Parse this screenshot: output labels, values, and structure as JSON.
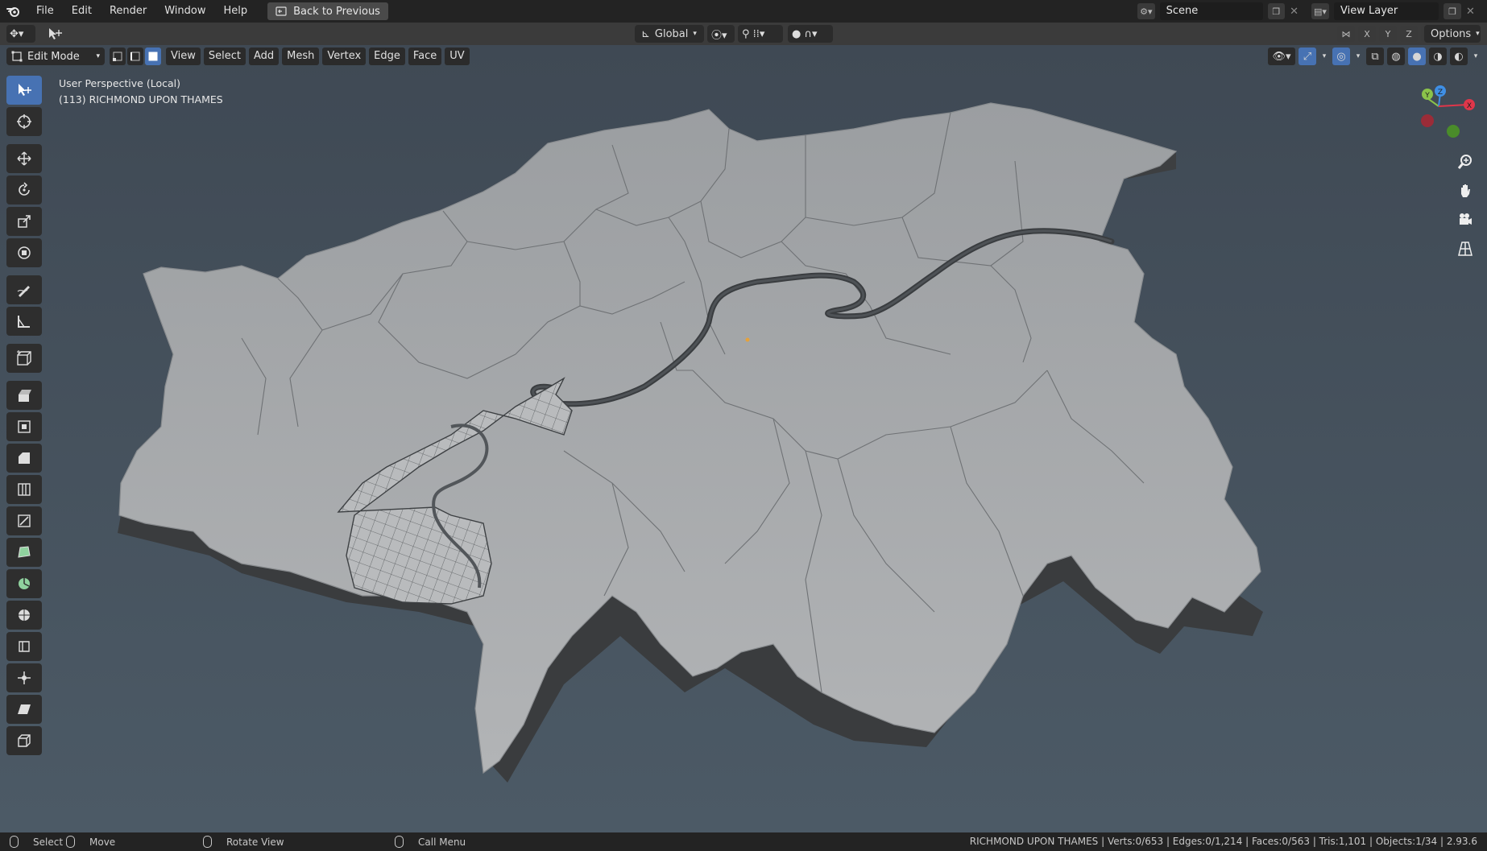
{
  "topbar": {
    "menus": [
      "File",
      "Edit",
      "Render",
      "Window",
      "Help"
    ],
    "back_label": "Back to Previous",
    "scene_name": "Scene",
    "view_layer": "View Layer"
  },
  "toolheader": {
    "orientation": "Global",
    "axes": [
      "X",
      "Y",
      "Z"
    ],
    "options_label": "Options"
  },
  "viewport_header": {
    "mode": "Edit Mode",
    "menus": [
      "View",
      "Select",
      "Add",
      "Mesh",
      "Vertex",
      "Edge",
      "Face",
      "UV"
    ]
  },
  "overlay": {
    "perspective": "User Perspective (Local)",
    "object": "(113) RICHMOND UPON THAMES"
  },
  "toolbar": {
    "tools": [
      "select-box",
      "cursor",
      "move",
      "rotate",
      "scale",
      "transform",
      "annotate",
      "measure",
      "add-cube",
      "extrude-region",
      "inset-faces",
      "bevel",
      "loop-cut",
      "knife",
      "poly-build",
      "spin",
      "smooth",
      "edge-slide",
      "shrink-fatten",
      "shear",
      "rip-region"
    ]
  },
  "gizmo": {
    "labels": [
      "Y",
      "Z",
      "X"
    ]
  },
  "statusbar": {
    "select": "Select",
    "move": "Move",
    "rotate": "Rotate View",
    "call_menu": "Call Menu",
    "stats": "RICHMOND UPON THAMES | Verts:0/653 | Edges:0/1,214 | Faces:0/563 | Tris:1,101 | Objects:1/34 | 2.93.6"
  },
  "colors": {
    "accent": "#4772b3",
    "viewport_bg": "#4a5560",
    "map_top": "#a2a5a8",
    "axis_x": "#e0364a",
    "axis_y": "#8bc34a",
    "axis_z": "#3f8fe5"
  }
}
